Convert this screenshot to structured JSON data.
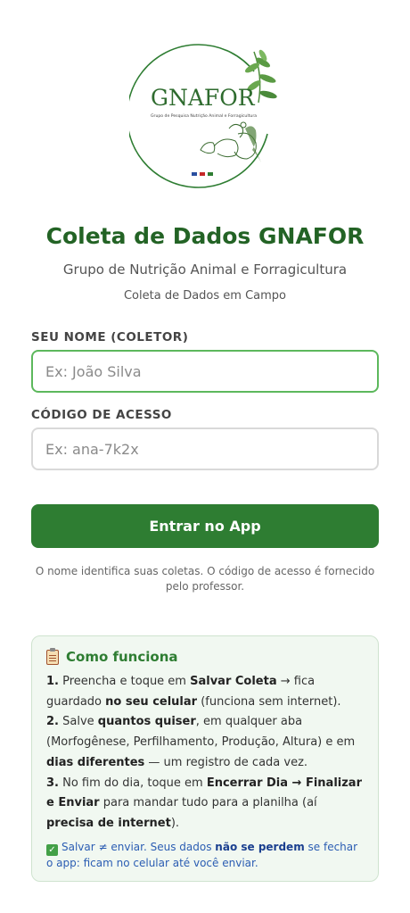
{
  "logo": {
    "name": "GNAFOR",
    "tagline": "Grupo de Pesquisa Nutrição Animal e Forragicultura"
  },
  "header": {
    "title": "Coleta de Dados GNAFOR",
    "subtitle": "Grupo de Nutrição Animal e Forragicultura",
    "caption": "Coleta de Dados em Campo"
  },
  "form": {
    "name_label": "SEU NOME (COLETOR)",
    "name_placeholder": "Ex: João Silva",
    "name_value": "",
    "code_label": "CÓDIGO DE ACESSO",
    "code_placeholder": "Ex: ana-7k2x",
    "code_value": "",
    "submit_label": "Entrar no App",
    "hint": "O nome identifica suas coletas. O código de acesso é fornecido pelo professor."
  },
  "how_it_works": {
    "icon": "clipboard-icon",
    "title": "Como funciona",
    "steps": [
      {
        "num": "1.",
        "t1": " Preencha e toque em ",
        "b1": "Salvar Coleta",
        "t2": " → fica guardado ",
        "b2": "no seu celular",
        "t3": " (funciona sem internet)."
      },
      {
        "num": "2.",
        "t1": " Salve ",
        "b1": "quantos quiser",
        "t2": ", em qualquer aba (Morfogênese, Perfilhamento, Produção, Altura) e em ",
        "b2": "dias diferentes",
        "t3": " — um registro de cada vez."
      },
      {
        "num": "3.",
        "t1": " No fim do dia, toque em ",
        "b1": "Encerrar Dia → Finalizar e Enviar",
        "t2": " para mandar tudo para a planilha (aí ",
        "b2": "precisa de internet",
        "t3": ")."
      }
    ],
    "note": {
      "icon": "check-icon",
      "t1": "Salvar ≠ enviar. Seus dados ",
      "b1": "não se perdem",
      "t2": " se fechar o app: ficam no celular até você enviar."
    }
  },
  "colors": {
    "primary": "#2e7d32",
    "title": "#236325",
    "focus_border": "#5cb85c",
    "card_bg": "#f1f8f1",
    "note_text": "#2b5db3"
  }
}
